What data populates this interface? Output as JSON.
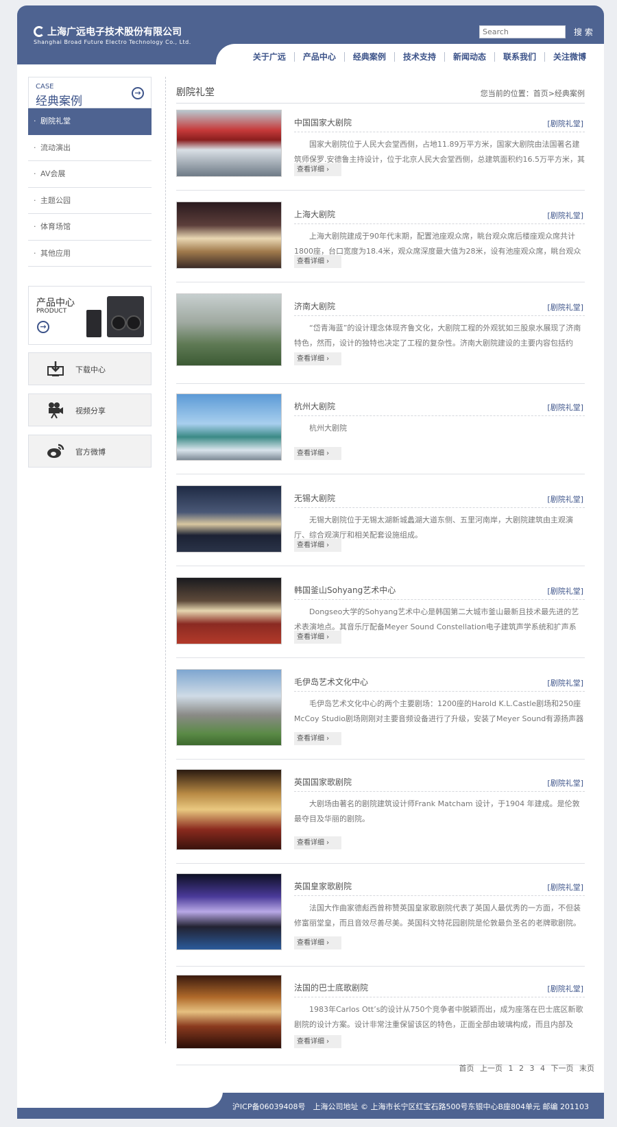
{
  "header": {
    "logo_cn": "上海广远电子技术股份有限公司",
    "logo_en": "Shanghai Broad Future Electro Technology Co., Ltd.",
    "search_placeholder": "Search",
    "search_button": "搜 索",
    "nav": [
      "关于广远",
      "产品中心",
      "经典案例",
      "技术支持",
      "新闻动态",
      "联系我们",
      "关注微博"
    ]
  },
  "sidebar": {
    "head_en": "CASE",
    "head_cn": "经典案例",
    "items": [
      "剧院礼堂",
      "流动演出",
      "AV会展",
      "主题公园",
      "体育场馆",
      "其他应用"
    ],
    "product_cn": "产品中心",
    "product_en": "PRODUCT",
    "boxes": [
      {
        "label": "下载中心",
        "icon": "download-monitor-icon"
      },
      {
        "label": "视频分享",
        "icon": "video-camera-icon"
      },
      {
        "label": "官方微博",
        "icon": "weibo-icon"
      }
    ]
  },
  "main": {
    "title": "剧院礼堂",
    "breadcrumb": "您当前的位置：首页>经典案例",
    "more_label": "查看详细 ›",
    "articles": [
      {
        "title": "中国国家大剧院",
        "category": "[剧院礼堂]",
        "desc": "国家大剧院位于人民大会堂西侧，占地11.89万平方米，国家大剧院由法国著名建筑师保罗.安德鲁主持设计，位于北京人民大会堂西侧，总建筑面积约16.5万平方米，其"
      },
      {
        "title": "上海大剧院",
        "category": "[剧院礼堂]",
        "desc": "上海大剧院建成于90年代末期，配置池座观众席，眺台观众席后楼座观众席共计1800座，台口宽度为18.4米，观众席深度最大值为28米，设有池座观众席，眺台观众"
      },
      {
        "title": "济南大剧院",
        "category": "[剧院礼堂]",
        "desc": "“岱青海蓝”的设计理念体现齐鲁文化，大剧院工程的外观犹如三股泉水展现了济南特色，然而，设计的独特也决定了工程的复杂性。济南大剧院建设的主要内容包括约"
      },
      {
        "title": "杭州大剧院",
        "category": "[剧院礼堂]",
        "desc": "杭州大剧院"
      },
      {
        "title": "无锡大剧院",
        "category": "[剧院礼堂]",
        "desc": "无锡大剧院位于无锡太湖新城蠡湖大道东侧、五里河南岸，大剧院建筑由主观演厅、综合观演厅和相关配套设施组成。"
      },
      {
        "title": "韩国釜山Sohyang艺术中心",
        "category": "[剧院礼堂]",
        "desc": "Dongseo大学的Sohyang艺术中心是韩国第二大城市釜山最新且技术最先进的艺术表演地点。其音乐厅配备Meyer Sound Constellation电子建筑声学系统和扩声系"
      },
      {
        "title": "毛伊岛艺术文化中心",
        "category": "[剧院礼堂]",
        "desc": "毛伊岛艺术文化中心的两个主要剧场：1200座的Harold K.L.Castle剧场和250座McCoy Studio剧场刚刚对主要音频设备进行了升级，安装了Meyer Sound有源扬声器"
      },
      {
        "title": "英国国家歌剧院",
        "category": "[剧院礼堂]",
        "desc": "大剧场由著名的剧院建筑设计师Frank Matcham 设计，于1904 年建成。是伦敦最夺目及华丽的剧院。"
      },
      {
        "title": "英国皇家歌剧院",
        "category": "[剧院礼堂]",
        "desc": "法国大作曲家德彪西曾称赞英国皇家歌剧院代表了英国人最优秀的一方面，不但装修富丽堂皇，而且音效尽善尽美。英国科文特花园剧院是伦敦最负圣名的老牌歌剧院。"
      },
      {
        "title": "法国的巴士底歌剧院",
        "category": "[剧院礼堂]",
        "desc": "1983年Carlos Ott’s的设计从750个竞争者中脱颖而出，成为座落在巴士底区新歌剧院的设计方案。设计非常注重保留该区的特色，正面全部由玻璃构成，而且内部及"
      }
    ],
    "pager": [
      "首页",
      "上一页",
      "1",
      "2",
      "3",
      "4",
      "下一页",
      "末页"
    ]
  },
  "footer": {
    "text": "沪ICP备06039408号　上海公司地址 © 上海市长宁区红宝石路500号东银中心B座804单元 邮编 201103"
  }
}
